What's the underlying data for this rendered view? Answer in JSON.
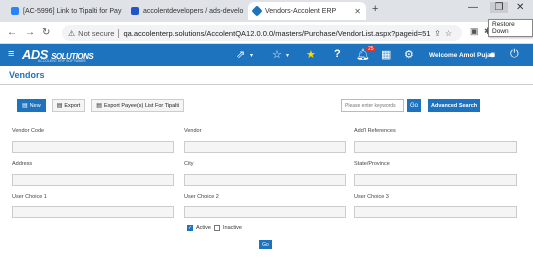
{
  "browser": {
    "tabs": [
      {
        "title": "[AC-5996] Link to Tipalti for Pay",
        "active": false
      },
      {
        "title": "accolentdevelopers / ads-develo",
        "active": false
      },
      {
        "title": "Vendors-Accolent ERP",
        "active": true
      }
    ],
    "new_tab": "+",
    "tooltip": "Restore Down",
    "not_secure": "Not secure",
    "url": "qa.accolenterp.solutions/AccolentQA12.0.0.0/masters/Purchase/VendorList.aspx?pageid=51"
  },
  "app": {
    "logo": "ADS",
    "logo_sub": "SOLUTIONS",
    "tagline": "ACCOLENT ERP SOFTWARE",
    "notification_count": "25",
    "welcome": "Welcome Amol Pujari"
  },
  "page": {
    "title": "Vendors",
    "toolbar": {
      "new": "New",
      "export": "Export",
      "export_payees": "Export Payee(s) List For Tipalti"
    },
    "search": {
      "placeholder": "Please enter keywords",
      "go": "Go",
      "advanced": "Advanced Search"
    },
    "labels": {
      "vendor_code": "Vendor Code",
      "vendor": "Vendor",
      "addl_refs": "Add'l References",
      "address": "Address",
      "city": "City",
      "state": "State/Province",
      "uc1": "User Choice 1",
      "uc2": "User Choice 2",
      "uc3": "User Choice 3"
    },
    "active_label": "Active",
    "inactive_label": "Inactive",
    "go": "Go"
  }
}
